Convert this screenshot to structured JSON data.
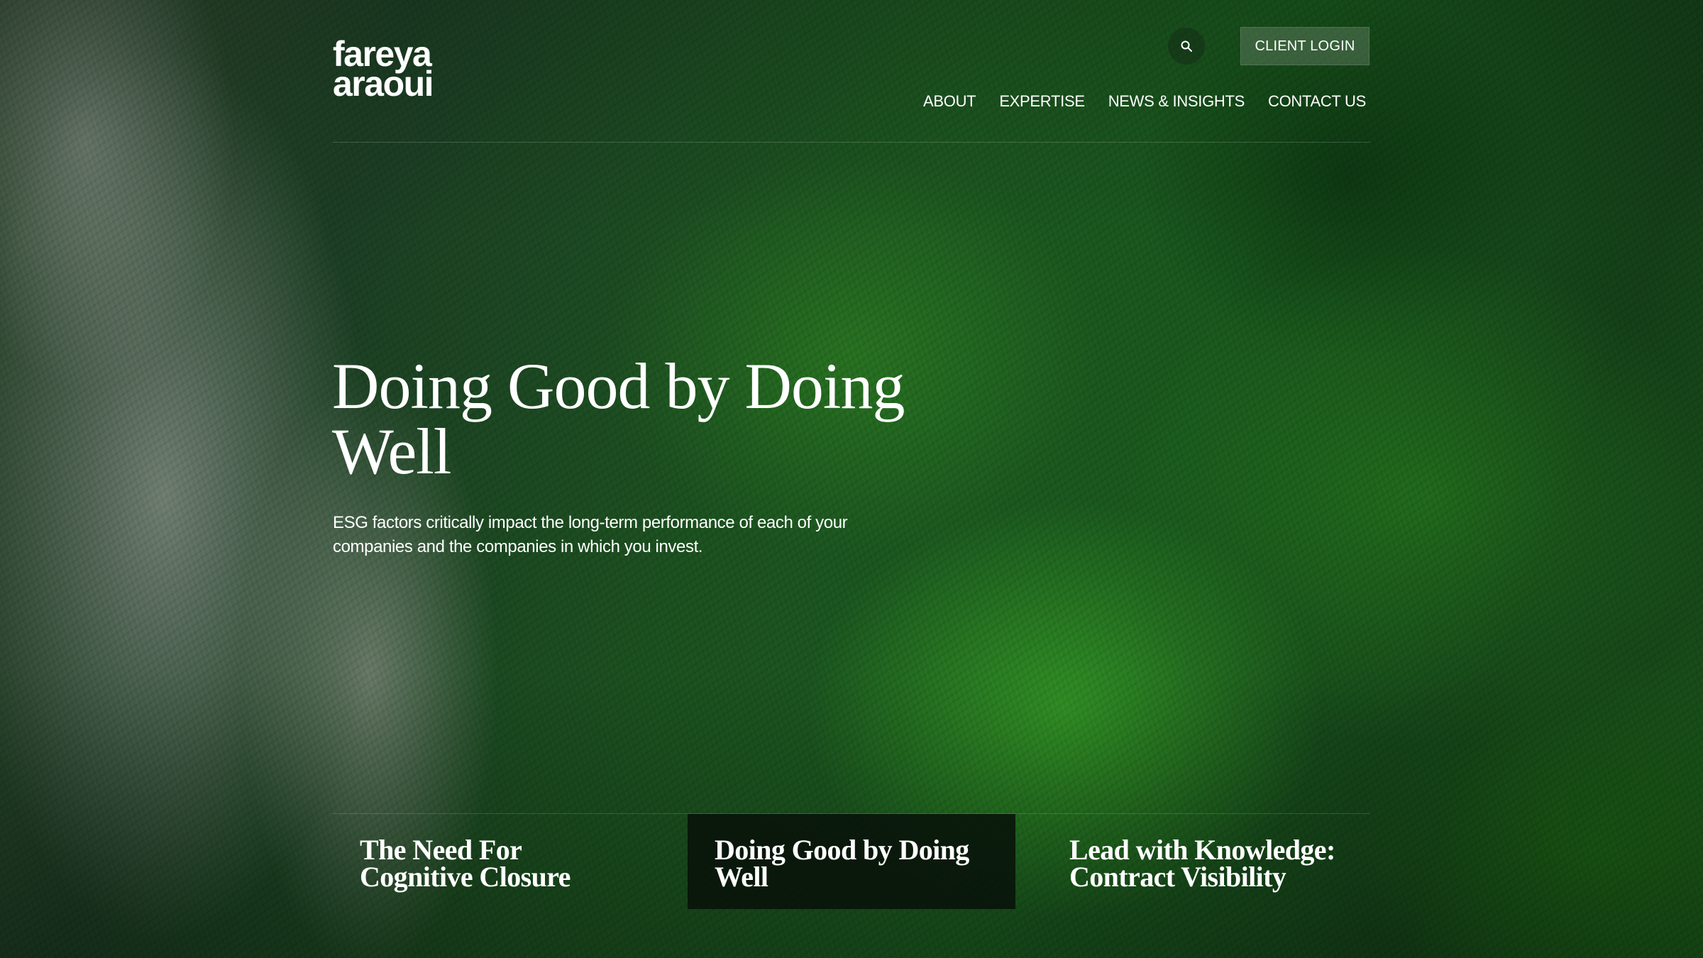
{
  "brand": {
    "logo_line1": "fareya",
    "logo_line2": "araoui"
  },
  "header": {
    "search_icon": "search-icon",
    "client_login_label": "CLIENT LOGIN"
  },
  "nav": {
    "items": [
      {
        "label": "ABOUT"
      },
      {
        "label": "EXPERTISE"
      },
      {
        "label": "NEWS & INSIGHTS"
      },
      {
        "label": "CONTACT US"
      }
    ]
  },
  "hero": {
    "headline": "Doing Good by Doing Well",
    "subtext": "ESG factors critically impact the long-term performance of each of your companies and the companies in which you invest."
  },
  "features": [
    {
      "title": "The Need For Cognitive Closure",
      "active": false
    },
    {
      "title": "Doing Good by Doing Well",
      "active": true
    },
    {
      "title": "Lead with Knowledge: Contract Visibility",
      "active": false
    }
  ],
  "colors": {
    "text": "#ffffff",
    "active_tab_bg": "#08120a",
    "forest_green": "#1b5e1f"
  }
}
